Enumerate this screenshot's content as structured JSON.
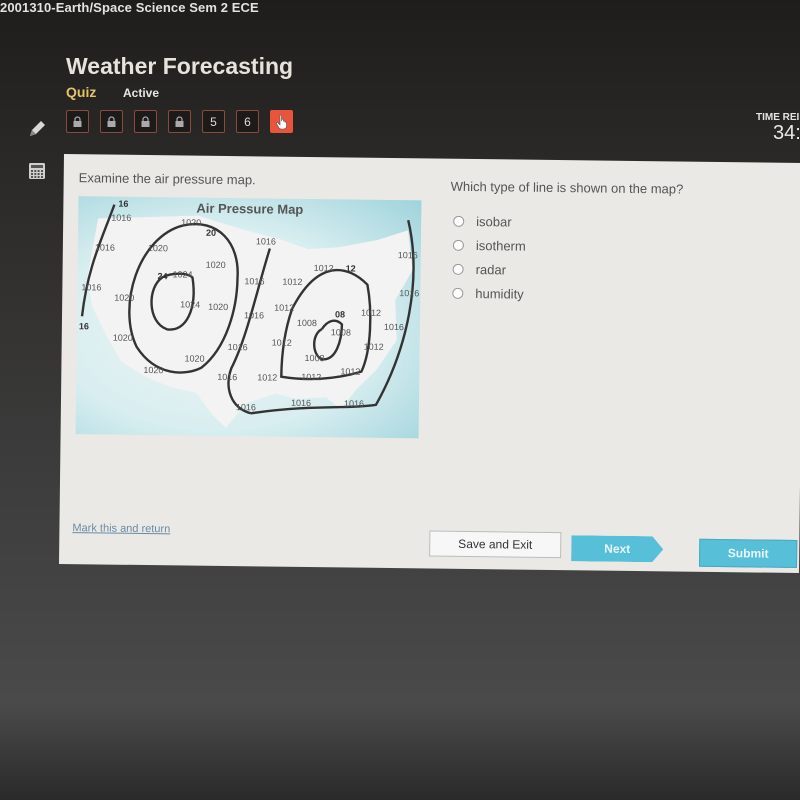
{
  "header": {
    "course_title": "2001310-Earth/Space Science Sem 2 ECE",
    "lesson_title": "Weather Forecasting",
    "activity_type": "Quiz",
    "status": "Active"
  },
  "question_nav": [
    {
      "label": "",
      "state": "locked",
      "icon": "lock-icon"
    },
    {
      "label": "",
      "state": "locked",
      "icon": "lock-icon"
    },
    {
      "label": "",
      "state": "locked",
      "icon": "lock-icon"
    },
    {
      "label": "",
      "state": "locked",
      "icon": "lock-icon"
    },
    {
      "label": "5",
      "state": "available"
    },
    {
      "label": "6",
      "state": "available"
    },
    {
      "label": "",
      "state": "current",
      "icon": "hand-pointer-icon"
    }
  ],
  "tools": [
    {
      "name": "pencil",
      "icon": "pencil-icon"
    },
    {
      "name": "calculator",
      "icon": "calculator-icon"
    }
  ],
  "timer": {
    "label": "TIME REI",
    "value": "34:"
  },
  "content": {
    "prompt": "Examine the air pressure map.",
    "map": {
      "title": "Air Pressure Map",
      "isobar_labels": [
        "16",
        "1016",
        "1020",
        "20",
        "1016",
        "1016",
        "1020",
        "1020",
        "1024",
        "24",
        "1016",
        "1012",
        "12",
        "1016",
        "1012",
        "1016",
        "1016",
        "1020",
        "1024",
        "1020",
        "1012",
        "08",
        "1012",
        "16",
        "1016",
        "1008",
        "1008",
        "1016",
        "1020",
        "1016",
        "1012",
        "1012",
        "1020",
        "1008",
        "1020",
        "1016",
        "1012",
        "1012",
        "1012",
        "1016",
        "1016",
        "1016"
      ]
    },
    "question": "Which type of line is shown on the map?",
    "options": [
      "isobar",
      "isotherm",
      "radar",
      "humidity"
    ]
  },
  "footer": {
    "mark_link": "Mark this and return",
    "save_exit": "Save and Exit",
    "next": "Next",
    "submit": "Submit"
  },
  "colors": {
    "accent_quiz": "#e3c36a",
    "current_question": "#e8553c",
    "primary_button": "#57bfd8"
  }
}
